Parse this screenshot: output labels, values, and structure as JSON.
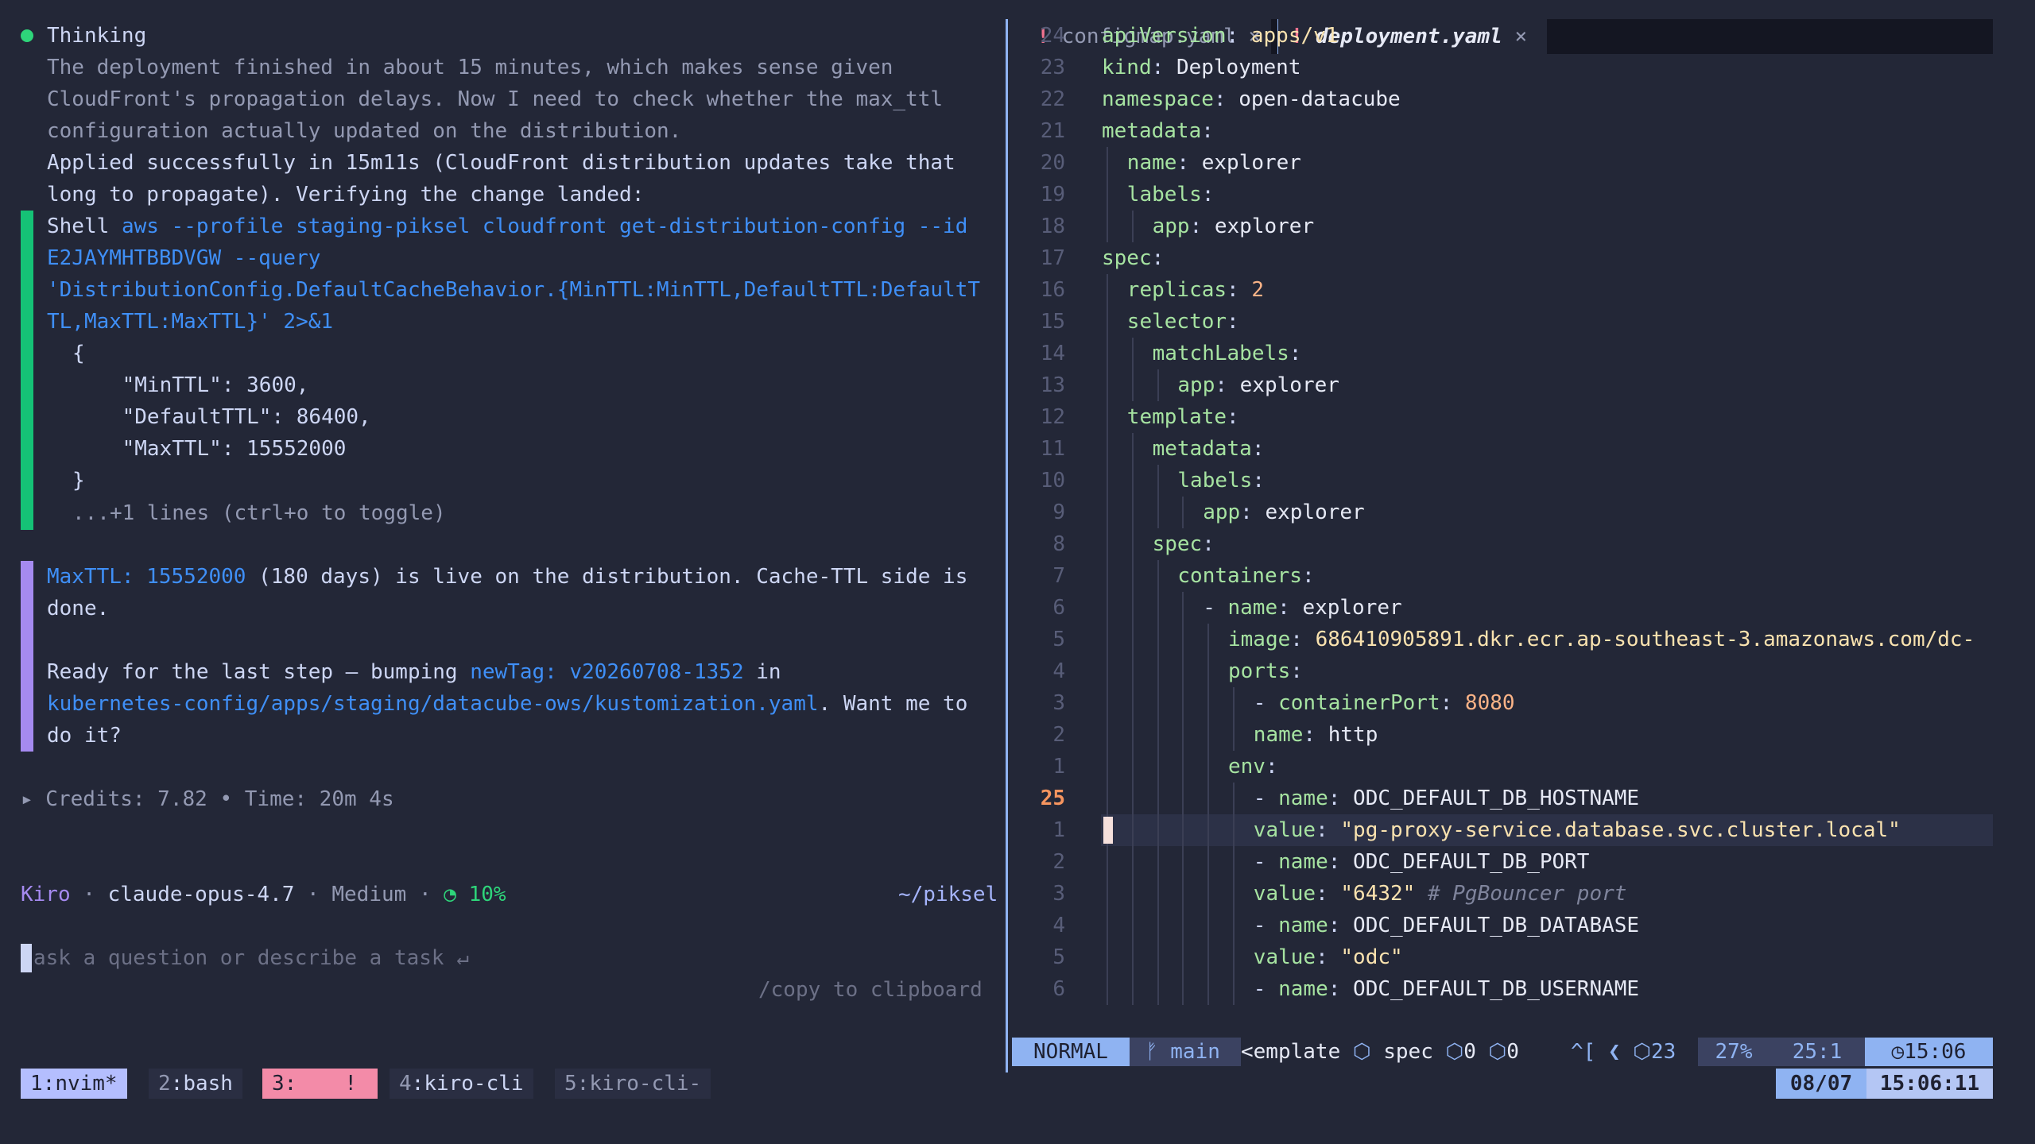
{
  "chat": {
    "thinking_label": "Thinking",
    "thinking_lines": [
      "The deployment finished in about 15 minutes, which makes sense given",
      "CloudFront's propagation delays. Now I need to check whether the max_ttl",
      "configuration actually updated on the distribution."
    ],
    "applied_lines": [
      "Applied successfully in 15m11s (CloudFront distribution updates take that",
      "long to propagate). Verifying the change landed:"
    ],
    "shell_label": "Shell",
    "shell_cmd_lines": [
      "aws --profile staging-piksel cloudfront get-distribution-config --id",
      "E2JAYMHTBBDVGW --query",
      "'DistributionConfig.DefaultCacheBehavior.{MinTTL:MinTTL,DefaultTTL:DefaultT",
      "TL,MaxTTL:MaxTTL}' 2>&1"
    ],
    "output_lines": [
      "{",
      "    \"MinTTL\": 3600,",
      "    \"DefaultTTL\": 86400,",
      "    \"MaxTTL\": 15552000",
      "}"
    ],
    "more_lines": "...+1 lines (ctrl+o to toggle)",
    "reply_hl1": "MaxTTL: 15552000",
    "reply_1a": " (180 days) is live on the distribution. Cache-TTL side is",
    "reply_1b": "done.",
    "reply_2a": "Ready for the last step — bumping ",
    "reply_hl2": "newTag: v20260708-1352",
    "reply_2b": " in",
    "reply_hl3": "kubernetes-config/apps/staging/datacube-ows/kustomization.yaml",
    "reply_2c": ". Want me to",
    "reply_2d": "do it?",
    "credits": "▸ Credits: 7.82 • Time: 20m 4s"
  },
  "prompt_bar": {
    "app": "Kiro",
    "model": "claude-opus-4.7",
    "effort": "Medium",
    "context": "◔ 10%",
    "cwd": "~/piksel",
    "placeholder": "ask a question or describe a task ↵",
    "copy_hint": "/copy to clipboard"
  },
  "editor": {
    "tabs": [
      {
        "bang": "!",
        "label": "configmap.yaml",
        "close": "×"
      },
      {
        "bang": "!",
        "label": "deployment.yaml",
        "close": "×"
      }
    ],
    "gutter": [
      "24",
      "23",
      "22",
      "21",
      "20",
      "19",
      "18",
      "17",
      "16",
      "15",
      "14",
      "13",
      "12",
      "11",
      "10",
      "9",
      "8",
      "7",
      "6",
      "5",
      "4",
      "3",
      "2",
      "1",
      "25",
      "1",
      "2",
      "3",
      "4",
      "5",
      "6"
    ],
    "lines": [
      {
        "key": "apiVersion",
        "val": "apps/v1"
      },
      {
        "key": "kind",
        "val": "Deployment"
      },
      {
        "key": "namespace",
        "val": "open-datacube"
      },
      {
        "key": "metadata",
        "val": ""
      },
      {
        "key": "name",
        "val": "explorer"
      },
      {
        "key": "labels",
        "val": ""
      },
      {
        "key": "app",
        "val": "explorer"
      },
      {
        "key": "spec",
        "val": ""
      },
      {
        "key": "replicas",
        "val": "2"
      },
      {
        "key": "selector",
        "val": ""
      },
      {
        "key": "matchLabels",
        "val": ""
      },
      {
        "key": "app",
        "val": "explorer"
      },
      {
        "key": "template",
        "val": ""
      },
      {
        "key": "metadata",
        "val": ""
      },
      {
        "key": "labels",
        "val": ""
      },
      {
        "key": "app",
        "val": "explorer"
      },
      {
        "key": "spec",
        "val": ""
      },
      {
        "key": "containers",
        "val": ""
      },
      {
        "key": "name",
        "val": "explorer"
      },
      {
        "key": "image",
        "val": "686410905891.dkr.ecr.ap-southeast-3.amazonaws.com/dc-"
      },
      {
        "key": "ports",
        "val": ""
      },
      {
        "key": "containerPort",
        "val": "8080"
      },
      {
        "key": "name",
        "val": "http"
      },
      {
        "key": "env",
        "val": ""
      },
      {
        "key": "name",
        "val": "ODC_DEFAULT_DB_HOSTNAME"
      },
      {
        "key": "value",
        "val": "\"pg-proxy-service.database.svc.cluster.local\""
      },
      {
        "key": "name",
        "val": "ODC_DEFAULT_DB_PORT"
      },
      {
        "key": "value",
        "val": "\"6432\"",
        "comment": "# PgBouncer port"
      },
      {
        "key": "name",
        "val": "ODC_DEFAULT_DB_DATABASE"
      },
      {
        "key": "value",
        "val": "\"odc\""
      },
      {
        "key": "name",
        "val": "ODC_DEFAULT_DB_USERNAME"
      }
    ]
  },
  "statusline": {
    "mode": "NORMAL",
    "branch": "main",
    "breadcrumb": "<emplate",
    "crumb2": "spec",
    "cnt1": "0",
    "cnt2": "0",
    "keys": "^[",
    "lsp": "23",
    "percent": "27%",
    "pos": "25:1",
    "time": "15:06",
    "date": "08/07",
    "clock": "15:06:11"
  },
  "tmux": {
    "windows": [
      {
        "num": "1",
        "name": "nvim*"
      },
      {
        "num": "2",
        "name": "bash"
      },
      {
        "num": "3",
        "name": "",
        "flag": "!"
      },
      {
        "num": "4",
        "name": "kiro-cli"
      },
      {
        "num": "5",
        "name": "kiro-cli-"
      }
    ]
  },
  "colors": {
    "bg": "#232737",
    "green": "#15c276",
    "purple": "#a58af0",
    "blue": "#3f8ff7",
    "mode_bg": "#8fb3f2"
  }
}
